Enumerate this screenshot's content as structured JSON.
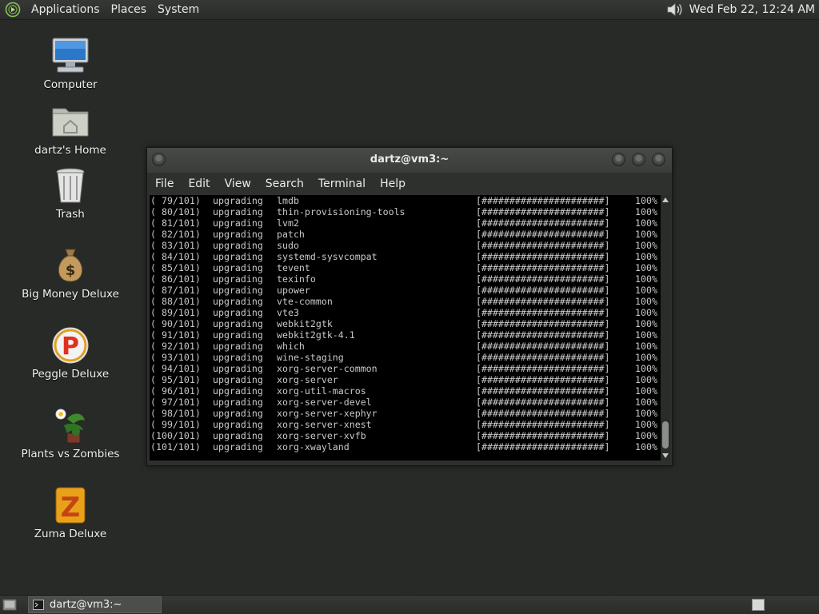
{
  "top_panel": {
    "menus": [
      "Applications",
      "Places",
      "System"
    ],
    "clock": "Wed Feb 22, 12:24 AM",
    "icons": {
      "logo": "distro-logo-icon",
      "volume": "volume-icon"
    }
  },
  "desktop_icons": [
    {
      "label": "Computer",
      "icon": "computer-icon"
    },
    {
      "label": "dartz's Home",
      "icon": "home-folder-icon"
    },
    {
      "label": "Trash",
      "icon": "trash-icon"
    },
    {
      "label": "Big Money Deluxe",
      "icon": "money-bag-icon"
    },
    {
      "label": "Peggle Deluxe",
      "icon": "peggle-icon"
    },
    {
      "label": "Plants vs Zombies",
      "icon": "plants-vs-zombies-icon"
    },
    {
      "label": "Zuma Deluxe",
      "icon": "zuma-icon"
    }
  ],
  "terminal": {
    "title": "dartz@vm3:~",
    "menu": [
      "File",
      "Edit",
      "View",
      "Search",
      "Terminal",
      "Help"
    ],
    "lines": [
      {
        "index": "( 79/101)",
        "action": "upgrading",
        "package": "lmdb",
        "bar": "[######################]",
        "percent": "100%"
      },
      {
        "index": "( 80/101)",
        "action": "upgrading",
        "package": "thin-provisioning-tools",
        "bar": "[######################]",
        "percent": "100%"
      },
      {
        "index": "( 81/101)",
        "action": "upgrading",
        "package": "lvm2",
        "bar": "[######################]",
        "percent": "100%"
      },
      {
        "index": "( 82/101)",
        "action": "upgrading",
        "package": "patch",
        "bar": "[######################]",
        "percent": "100%"
      },
      {
        "index": "( 83/101)",
        "action": "upgrading",
        "package": "sudo",
        "bar": "[######################]",
        "percent": "100%"
      },
      {
        "index": "( 84/101)",
        "action": "upgrading",
        "package": "systemd-sysvcompat",
        "bar": "[######################]",
        "percent": "100%"
      },
      {
        "index": "( 85/101)",
        "action": "upgrading",
        "package": "tevent",
        "bar": "[######################]",
        "percent": "100%"
      },
      {
        "index": "( 86/101)",
        "action": "upgrading",
        "package": "texinfo",
        "bar": "[######################]",
        "percent": "100%"
      },
      {
        "index": "( 87/101)",
        "action": "upgrading",
        "package": "upower",
        "bar": "[######################]",
        "percent": "100%"
      },
      {
        "index": "( 88/101)",
        "action": "upgrading",
        "package": "vte-common",
        "bar": "[######################]",
        "percent": "100%"
      },
      {
        "index": "( 89/101)",
        "action": "upgrading",
        "package": "vte3",
        "bar": "[######################]",
        "percent": "100%"
      },
      {
        "index": "( 90/101)",
        "action": "upgrading",
        "package": "webkit2gtk",
        "bar": "[######################]",
        "percent": "100%"
      },
      {
        "index": "( 91/101)",
        "action": "upgrading",
        "package": "webkit2gtk-4.1",
        "bar": "[######################]",
        "percent": "100%"
      },
      {
        "index": "( 92/101)",
        "action": "upgrading",
        "package": "which",
        "bar": "[######################]",
        "percent": "100%"
      },
      {
        "index": "( 93/101)",
        "action": "upgrading",
        "package": "wine-staging",
        "bar": "[######################]",
        "percent": "100%"
      },
      {
        "index": "( 94/101)",
        "action": "upgrading",
        "package": "xorg-server-common",
        "bar": "[######################]",
        "percent": "100%"
      },
      {
        "index": "( 95/101)",
        "action": "upgrading",
        "package": "xorg-server",
        "bar": "[######################]",
        "percent": "100%"
      },
      {
        "index": "( 96/101)",
        "action": "upgrading",
        "package": "xorg-util-macros",
        "bar": "[######################]",
        "percent": "100%"
      },
      {
        "index": "( 97/101)",
        "action": "upgrading",
        "package": "xorg-server-devel",
        "bar": "[######################]",
        "percent": "100%"
      },
      {
        "index": "( 98/101)",
        "action": "upgrading",
        "package": "xorg-server-xephyr",
        "bar": "[######################]",
        "percent": "100%"
      },
      {
        "index": "( 99/101)",
        "action": "upgrading",
        "package": "xorg-server-xnest",
        "bar": "[######################]",
        "percent": "100%"
      },
      {
        "index": "(100/101)",
        "action": "upgrading",
        "package": "xorg-server-xvfb",
        "bar": "[######################]",
        "percent": "100%"
      },
      {
        "index": "(101/101)",
        "action": "upgrading",
        "package": "xorg-xwayland",
        "bar": "[######################]",
        "percent": "100%"
      }
    ]
  },
  "bottom_panel": {
    "task_label": "dartz@vm3:~",
    "icons": {
      "show_desktop": "show-desktop-icon",
      "task": "terminal-icon",
      "workspace": "workspace-switcher"
    }
  },
  "colors": {
    "desktop_bg": "#272a27",
    "panel_bg": "#2f322f",
    "terminal_bg": "#000000",
    "terminal_fg": "#c9c9c9"
  }
}
